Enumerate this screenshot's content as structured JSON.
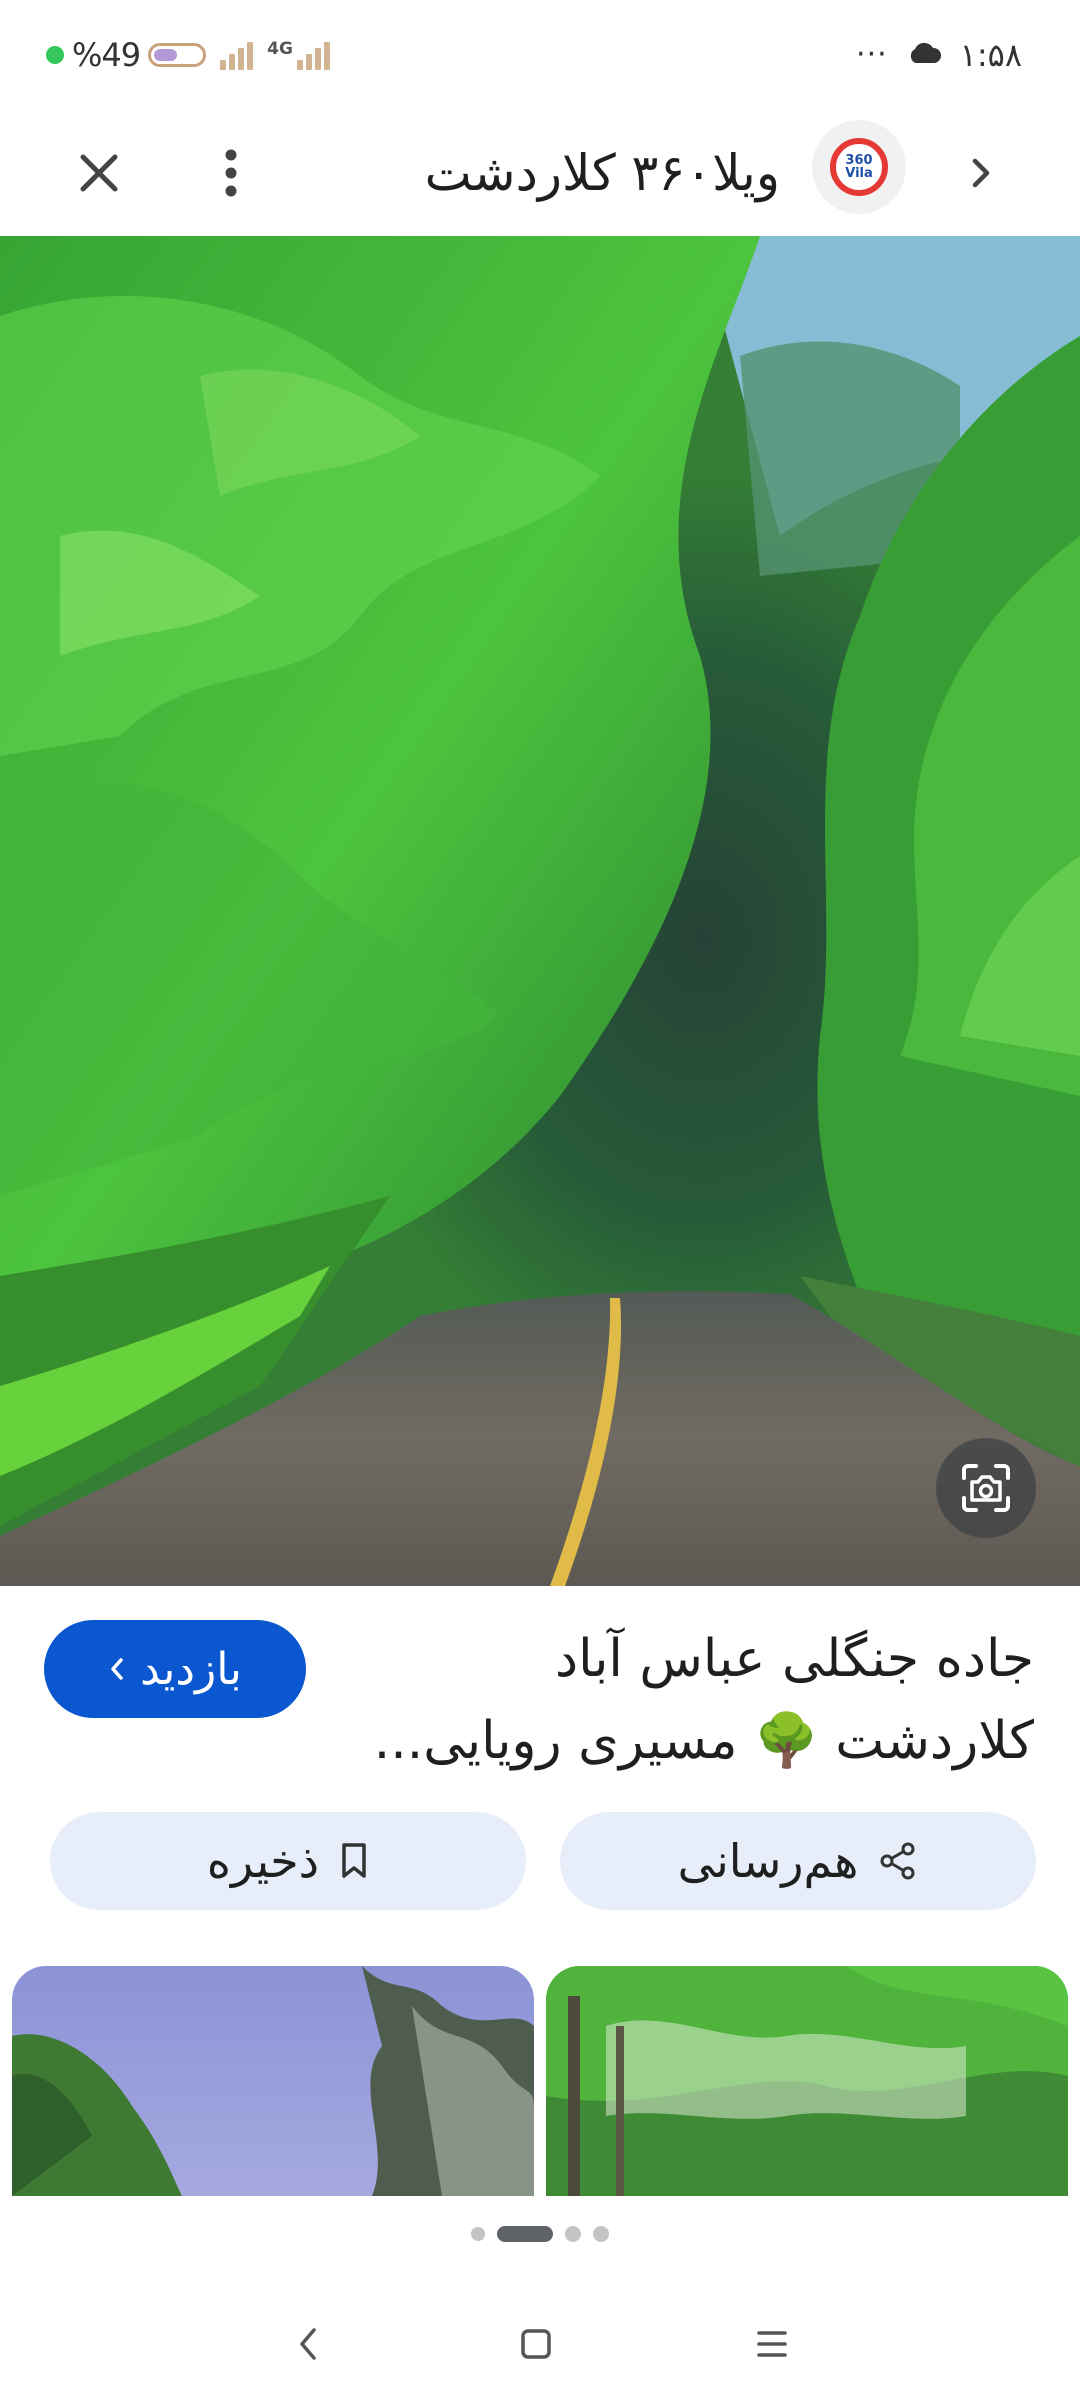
{
  "status_bar": {
    "battery_percent": "%49",
    "battery_level": 0.49,
    "network": "4G",
    "more": "···",
    "time": "۱:۵۸"
  },
  "app_bar": {
    "title": "ویلا۳۶۰ کلاردشت",
    "logo_line1": "360",
    "logo_line2": "Vila",
    "icons": {
      "close": "close-icon",
      "menu": "more-vert-icon",
      "forward": "chevron-right-icon"
    }
  },
  "result": {
    "caption_line1": "جاده جنگلی عباس آباد",
    "caption_line2": "کلاردشت 🌳 مسیری رویایی...",
    "visit_label": "بازدید",
    "share_label": "هم‌رسانی",
    "save_label": "ذخیره"
  },
  "pager": {
    "count": 4,
    "active_index": 1
  },
  "colors": {
    "accent": "#0b57d0",
    "chip_bg": "#e8edfa",
    "battery_dot": "#34c759"
  }
}
